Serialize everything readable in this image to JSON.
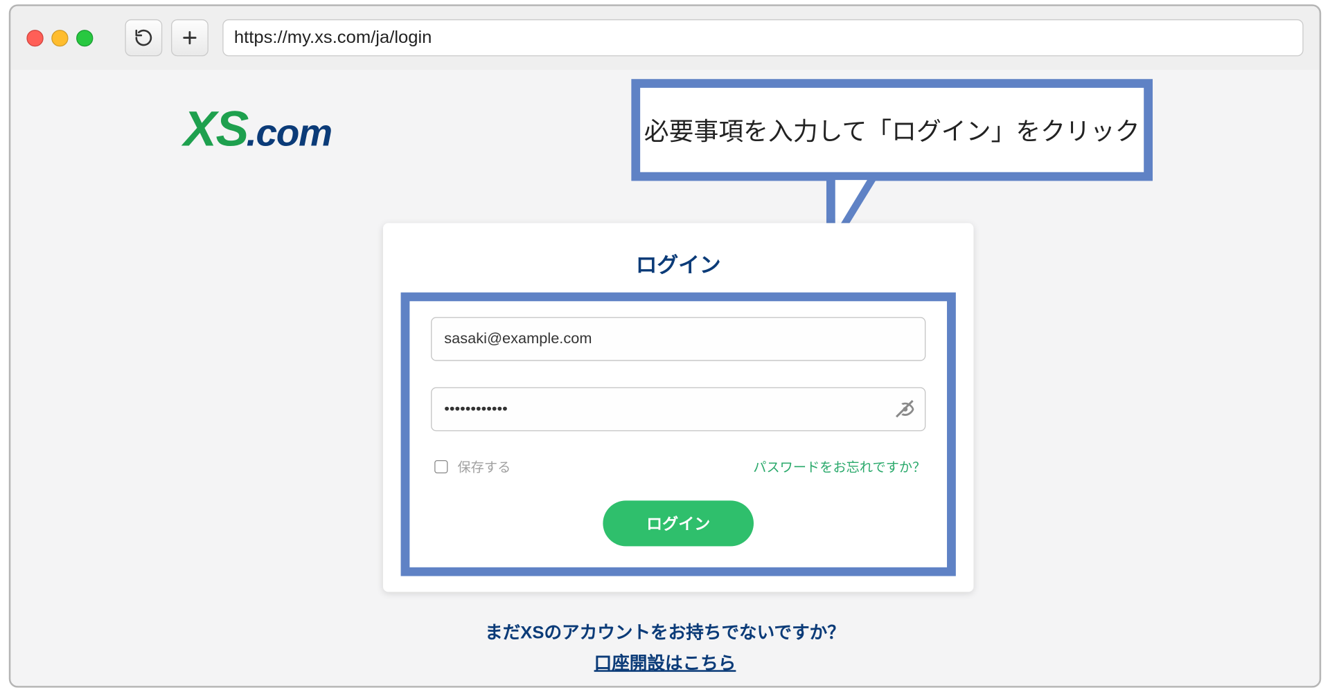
{
  "browser": {
    "url": "https://my.xs.com/ja/login"
  },
  "logo": {
    "xs": "XS",
    "dotcom": ".com"
  },
  "callout": {
    "text": "必要事項を入力して「ログイン」をクリック"
  },
  "login": {
    "title": "ログイン",
    "email_value": "sasaki@example.com",
    "password_value": "••••••••••••",
    "remember_label": "保存する",
    "forgot_label": "パスワードをお忘れですか？",
    "submit_label": "ログイン"
  },
  "below": {
    "question": "まだXSのアカウントをお持ちでないですか？",
    "register_link": "口座開設はこちら"
  }
}
